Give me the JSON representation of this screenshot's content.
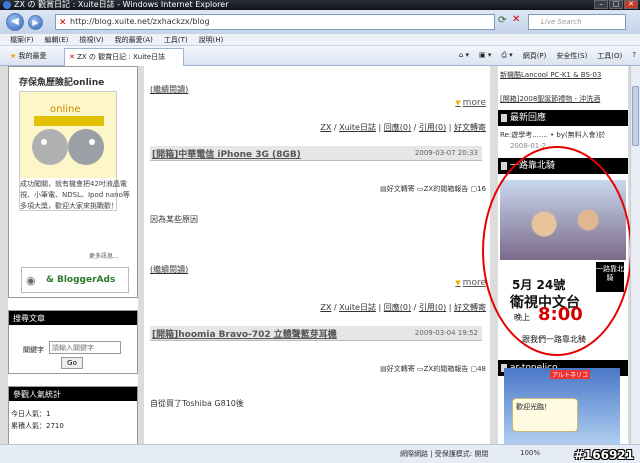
{
  "window": {
    "title": "ZX の 觀賞日記 : Xuite日誌 - Windows Internet Explorer"
  },
  "address": {
    "url": "http://blog.xuite.net/zxhackzx/blog",
    "search_placeholder": "Live Search"
  },
  "menu": [
    "檔案(F)",
    "編輯(E)",
    "檢視(V)",
    "我的最愛(A)",
    "工具(T)",
    "說明(H)"
  ],
  "tabs": {
    "favorites": "我的最愛",
    "active_tab": "ZX の 觀賞日記 : Xuite日誌"
  },
  "commandbar": {
    "page": "網頁(P)",
    "safety": "安全性(S)",
    "tools": "工具(O)"
  },
  "left": {
    "promo_title": "存保魚歷險記online",
    "promo_text": "成功闖關，就有機會把42吋液晶電視、小筆電、NDSL、Ipod nano等多項大獎，歡迎大家來挑戰歡！",
    "more_info": "更多訊息...",
    "bloggerads": "& BloggerAds",
    "search_title": "搜尋文章",
    "keyword_label": "關鍵字",
    "keyword_placeholder": "請輸入關鍵字",
    "go_button": "Go",
    "stats_title": "參觀人氣統計",
    "today_visitors": "今日人氣：1",
    "total_visitors": "累積人氣：2710"
  },
  "main": {
    "read_more_1": "(繼續閱讀)",
    "more_1": "more",
    "meta_1": {
      "category": "ZX",
      "blog": "Xuite日誌",
      "replies": "回應(0)",
      "trackback": "引用(0)",
      "share": "好文轉寄"
    },
    "post_1": {
      "title": "[開箱]中華電信 iPhone 3G (8GB)",
      "date": "2009-03-07 20:33"
    },
    "actions_1": {
      "forward": "好文轉寄",
      "report": "ZX的閱箱報告",
      "count": "16"
    },
    "body_1": "因為某些原因",
    "read_more_2": "(繼續閱讀)",
    "more_2": "more",
    "meta_2": {
      "category": "ZX",
      "blog": "Xuite日誌",
      "replies": "回應(0)",
      "trackback": "引用(0)",
      "share": "好文轉寄"
    },
    "post_2": {
      "title": "[開箱]hoomia Bravo-702 立體聲藍芽耳機",
      "date": "2009-03-04 19:52"
    },
    "actions_2": {
      "forward": "好文轉寄",
      "report": "ZX的閱箱報告",
      "count": "48"
    },
    "body_2": "自從買了Toshiba G810後"
  },
  "right": {
    "links": [
      "新機酷Lancool PC-K1 & BS-03",
      "[開箱]2008聖誕節禮物 - 沖洗酒"
    ],
    "recent_title": "最新回應",
    "recent_text": "Re:遊學考....... • by(無料入會)於",
    "recent_date": "2008-01-2",
    "event_title": "一路靠北騎",
    "poster": {
      "date": "5月 24號",
      "channel": "衛視中文台",
      "evening": "晚上",
      "time": "8:00",
      "tagline": "跟我們一路靠北騎",
      "badge": "一路靠北騎"
    },
    "widget_title": "ar-tonelico",
    "widget_tag": "アルトネリコ",
    "widget_bubble": "歡迎光臨！"
  },
  "status": {
    "zone": "網際網路 | 受保護模式: 開閉",
    "zoom": "100%"
  },
  "watermark": "#166921"
}
